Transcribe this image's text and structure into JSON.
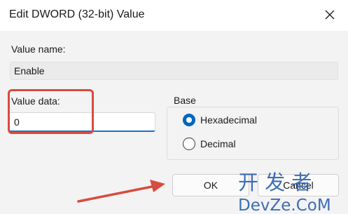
{
  "window": {
    "title": "Edit DWORD (32-bit) Value",
    "close_icon": "close-icon"
  },
  "value_name": {
    "label": "Value name:",
    "value": "Enable"
  },
  "value_data": {
    "label": "Value data:",
    "value": "0"
  },
  "base": {
    "label": "Base",
    "options": [
      "Hexadecimal",
      "Decimal"
    ],
    "selected": "Hexadecimal"
  },
  "buttons": {
    "ok_label": "OK",
    "cancel_label": "Cancel"
  },
  "annotation": {
    "highlight_color": "#d84b3f",
    "arrow_color": "#d84b3f"
  },
  "watermark": {
    "line1": "开 发 者",
    "line2": "DevZe.CoM"
  },
  "colors": {
    "accent": "#1a73c7",
    "radio_selected": "#0067c0"
  }
}
